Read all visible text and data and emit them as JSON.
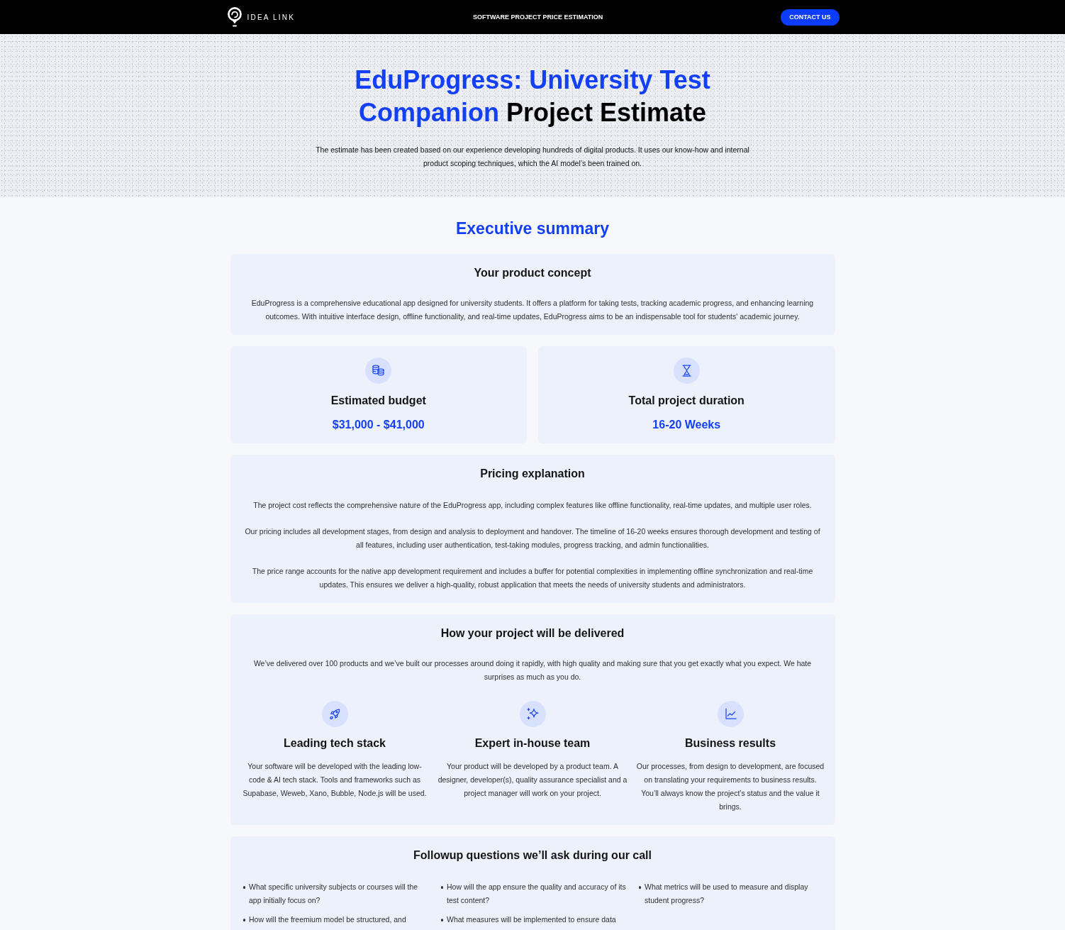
{
  "header": {
    "brand": "IDEA LINK",
    "title": "SOFTWARE PROJECT PRICE ESTIMATION",
    "contact_button": "CONTACT US"
  },
  "hero": {
    "title_highlight": "EduProgress: University Test Companion",
    "title_rest": "Project Estimate",
    "description": "The estimate has been created based on our experience developing hundreds of digital products. It uses our know-how and internal product scoping techniques, which the AI model’s been trained on."
  },
  "summary_heading": "Executive summary",
  "concept": {
    "title": "Your product concept",
    "text": "EduProgress is a comprehensive educational app designed for university students. It offers a platform for taking tests, tracking academic progress, and enhancing learning outcomes. With intuitive interface design, offline functionality, and real-time updates, EduProgress aims to be an indispensable tool for students' academic journey."
  },
  "stats": [
    {
      "kind": "budget",
      "title": "Estimated budget",
      "value": "$31,000 - $41,000"
    },
    {
      "kind": "duration",
      "title": "Total project duration",
      "value": "16-20 Weeks"
    }
  ],
  "pricing": {
    "title": "Pricing explanation",
    "paragraphs": [
      "The project cost reflects the comprehensive nature of the EduProgress app, including complex features like offline functionality, real-time updates, and multiple user roles.",
      "Our pricing includes all development stages, from design and analysis to deployment and handover. The timeline of 16-20 weeks ensures thorough development and testing of all features, including user authentication, test-taking modules, progress tracking, and admin functionalities.",
      "The price range accounts for the native app development requirement and includes a buffer for potential complexities in implementing offline synchronization and real-time updates. This ensures we deliver a high-quality, robust application that meets the needs of university students and administrators."
    ]
  },
  "delivery": {
    "title": "How your project will be delivered",
    "intro": "We’ve delivered over 100 products and we’ve built our processes around doing it rapidly, with high quality and making sure that you get exactly what you expect. We hate surprises as much as you do.",
    "features": [
      {
        "kind": "tech",
        "title": "Leading tech stack",
        "text": "Your software will be developed with the leading low-code & AI tech stack. Tools and frameworks such as Supabase, Weweb, Xano, Bubble, Node.js will be used."
      },
      {
        "kind": "team",
        "title": "Expert in-house team",
        "text": "Your product will be developed by a product team. A designer, developer(s), quality assurance specialist and a project manager will work on your project."
      },
      {
        "kind": "results",
        "title": "Business results",
        "text": "Our processes, from design to development, are focused on translating your requirements to business results. You’ll always know the project’s status and the value it brings."
      }
    ]
  },
  "followup": {
    "title": "Followup questions we’ll ask during our call",
    "questions": [
      "What specific university subjects or courses will the app initially focus on?",
      "How will the app ensure the quality and accuracy of its test content?",
      "What metrics will be used to measure and display student progress?",
      "How will the freemium model be structured, and",
      "What measures will be implemented to ensure data"
    ]
  }
}
